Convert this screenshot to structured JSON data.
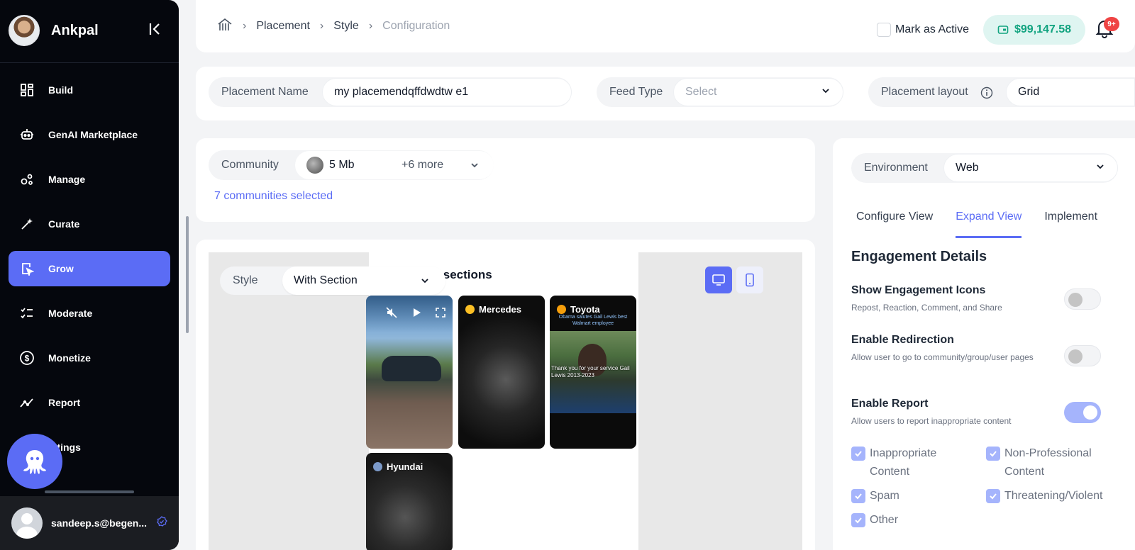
{
  "sidebar": {
    "title": "Ankpal",
    "items": [
      {
        "label": "Build",
        "icon": "build-icon"
      },
      {
        "label": "GenAI Marketplace",
        "icon": "robot-icon"
      },
      {
        "label": "Manage",
        "icon": "manage-icon"
      },
      {
        "label": "Curate",
        "icon": "magic-wand-icon"
      },
      {
        "label": "Grow",
        "icon": "grow-icon"
      },
      {
        "label": "Moderate",
        "icon": "moderate-icon"
      },
      {
        "label": "Monetize",
        "icon": "dollar-icon"
      },
      {
        "label": "Report",
        "icon": "chart-line-icon"
      },
      {
        "label": "ettings",
        "icon": "settings-icon"
      }
    ],
    "active_item": "Grow",
    "user_email": "sandeep.s@begen..."
  },
  "breadcrumb": {
    "items": [
      "Placement",
      "Style"
    ],
    "current": "Configuration"
  },
  "header": {
    "mark_active_label": "Mark as Active",
    "balance": "$99,147.58",
    "notification_badge": "9+"
  },
  "fields": {
    "placement_name_label": "Placement Name",
    "placement_name_value": "my placemendqffdwdtw e1",
    "feed_type_label": "Feed Type",
    "feed_type_placeholder": "Select",
    "placement_layout_label": "Placement layout",
    "placement_layout_value": "Grid"
  },
  "community": {
    "label": "Community",
    "selected_name": "5 Mb",
    "more": "+6 more",
    "selected_count_text": "7 communities selected"
  },
  "preview": {
    "style_label": "Style",
    "style_value": "With Section",
    "heading_partial": "th sections",
    "tiles": [
      {
        "label": ""
      },
      {
        "label": "Mercedes"
      },
      {
        "label": "Toyota",
        "caption_top": "Obama salutes Gail Lewis best Walmart employee",
        "caption_bottom": "Thank you for your service Gail Lewis 2013-2023"
      },
      {
        "label": "Hyundai"
      }
    ]
  },
  "right_panel": {
    "environment_label": "Environment",
    "environment_value": "Web",
    "tabs": [
      "Configure View",
      "Expand View",
      "Implement"
    ],
    "active_tab": "Expand View",
    "section_title": "Engagement Details",
    "options": [
      {
        "title": "Show Engagement Icons",
        "desc": "Repost, Reaction, Comment, and Share",
        "enabled": false
      },
      {
        "title": "Enable Redirection",
        "desc": "Allow user to go to community/group/user pages",
        "enabled": false
      },
      {
        "title": "Enable Report",
        "desc": "Allow users to report inappropriate content",
        "enabled": true
      }
    ],
    "report_reasons": [
      {
        "label": "Inappropriate Content",
        "checked": true
      },
      {
        "label": "Non-Professional Content",
        "checked": true
      },
      {
        "label": "Spam",
        "checked": true
      },
      {
        "label": "Threatening/Violent",
        "checked": true
      },
      {
        "label": "Other",
        "checked": true
      }
    ]
  },
  "colors": {
    "accent": "#5b6cf5",
    "sidebar_bg": "#05070d",
    "balance_green": "#10a37f",
    "toggle_on": "#a5b4fc"
  }
}
